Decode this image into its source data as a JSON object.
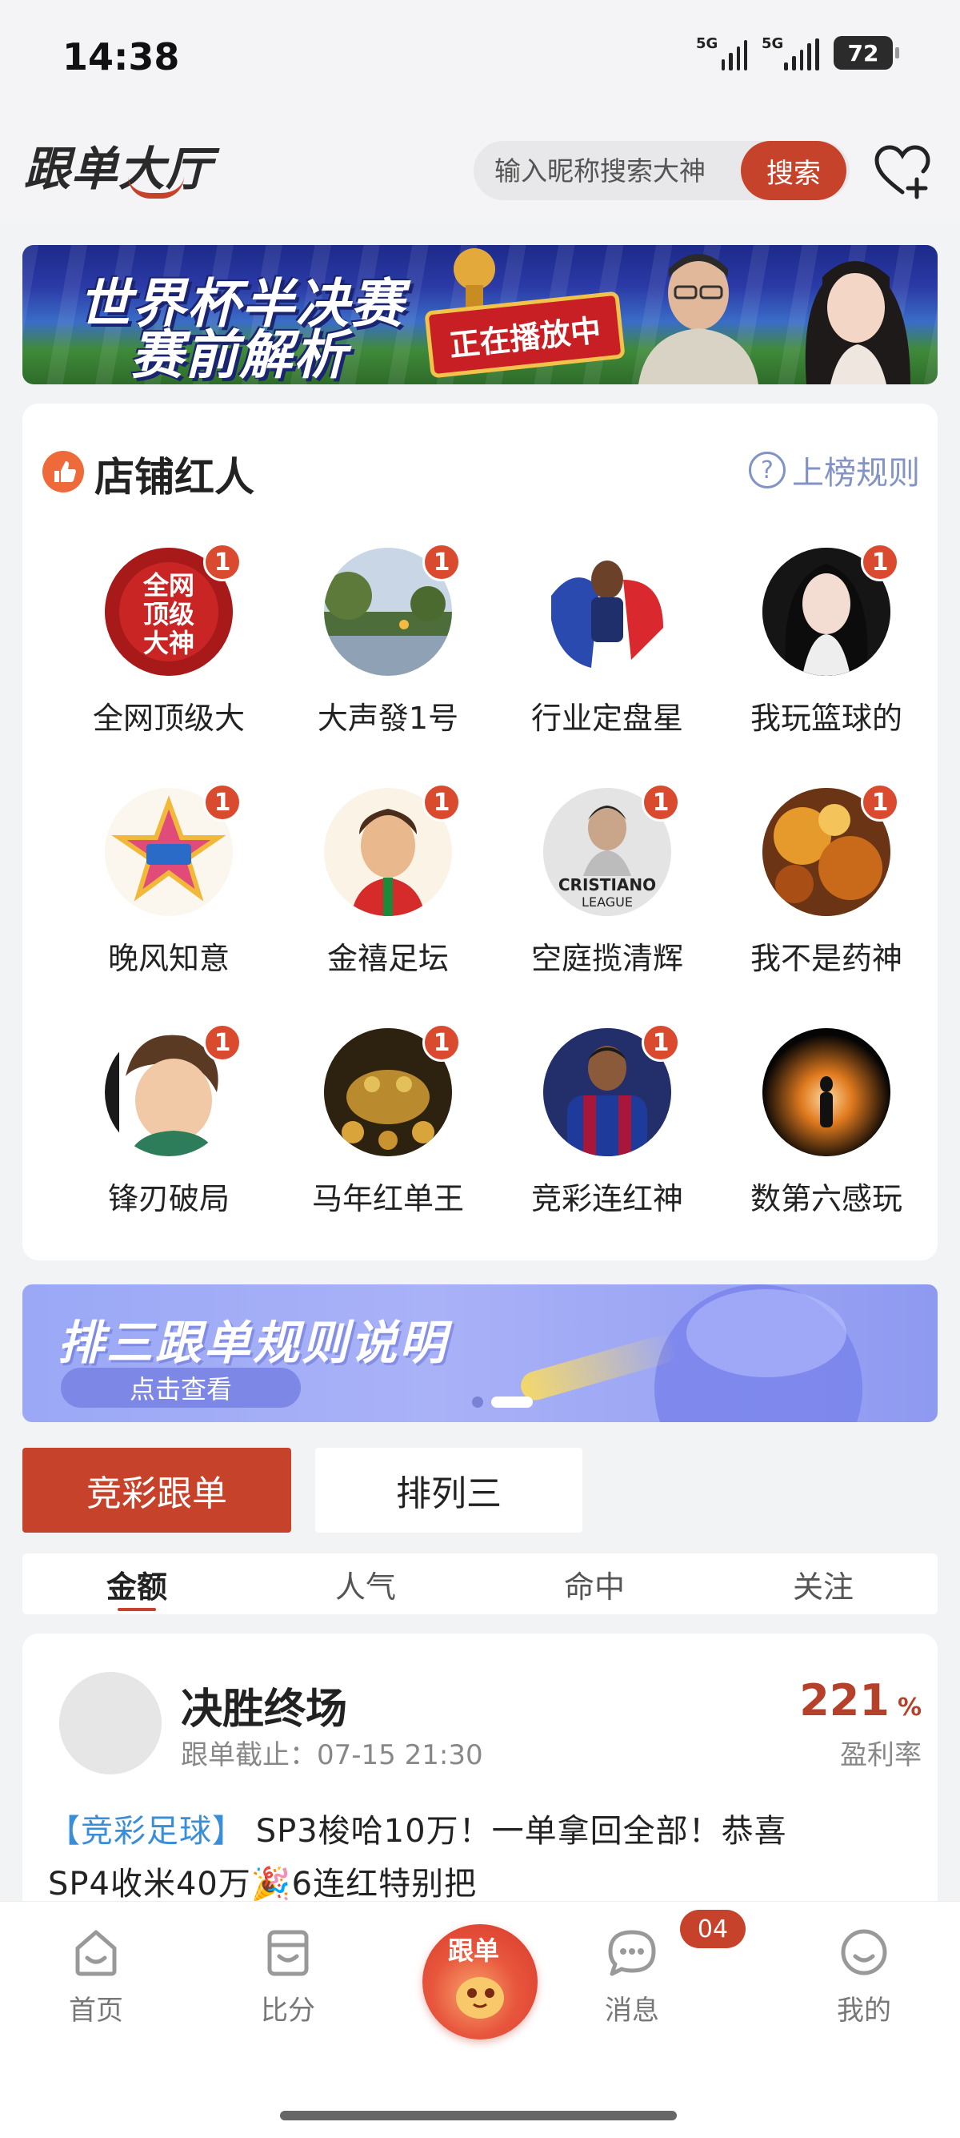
{
  "status_bar": {
    "time": "14:38",
    "signal1_label": "5G",
    "signal2_label": "5G",
    "battery": "72"
  },
  "header": {
    "logo": "跟单大厅",
    "search_placeholder": "输入昵称搜索大神",
    "search_button": "搜索",
    "favorites_icon": "heart-plus-icon"
  },
  "banner_top": {
    "line1": "世界杯半决赛",
    "line2": "赛前解析",
    "live_badge": "正在播放中"
  },
  "kol_section": {
    "title": "店铺红人",
    "rules_label": "上榜规则",
    "items": [
      {
        "name": "全网顶级大",
        "badge": "1",
        "avatar_text": "全网顶级大神"
      },
      {
        "name": "大声發1号",
        "badge": "1"
      },
      {
        "name": "行业定盘星",
        "badge": ""
      },
      {
        "name": "我玩篮球的",
        "badge": "1"
      },
      {
        "name": "晚风知意",
        "badge": "1"
      },
      {
        "name": "金禧足坛",
        "badge": "1"
      },
      {
        "name": "空庭揽清辉",
        "badge": "1",
        "avatar_text": "CRISTIANO LEAGUE"
      },
      {
        "name": "我不是药神",
        "badge": "1"
      },
      {
        "name": "锋刃破局",
        "badge": "1"
      },
      {
        "name": "马年红单王",
        "badge": "1"
      },
      {
        "name": "竞彩连红神",
        "badge": "1"
      },
      {
        "name": "数第六感玩",
        "badge": ""
      }
    ]
  },
  "banner_rules": {
    "title": "排三跟单规则说明",
    "button": "点击查看"
  },
  "main_tabs": [
    {
      "label": "竞彩跟单",
      "active": true
    },
    {
      "label": "排列三",
      "active": false
    }
  ],
  "sub_tabs": [
    {
      "label": "金额",
      "active": true
    },
    {
      "label": "人气",
      "active": false
    },
    {
      "label": "命中",
      "active": false
    },
    {
      "label": "关注",
      "active": false
    }
  ],
  "post": {
    "title": "决胜终场",
    "deadline": "跟单截止：07-15 21:30",
    "rate_value": "221",
    "rate_unit": "%",
    "rate_label": "盈利率",
    "tag": "【竞彩足球】",
    "text_line1": " SP3梭哈10万！一单拿回全部！恭喜",
    "text_line2": "SP4收米40万🎉6连红特别把"
  },
  "bottom_nav": [
    {
      "label": "首页"
    },
    {
      "label": "比分"
    },
    {
      "label": "跟单"
    },
    {
      "label": "消息",
      "badge": "04"
    },
    {
      "label": "我的"
    }
  ],
  "colors": {
    "accent": "#c7422a",
    "tag_blue": "#3a8ed8",
    "rules_blue": "#8493c5"
  }
}
